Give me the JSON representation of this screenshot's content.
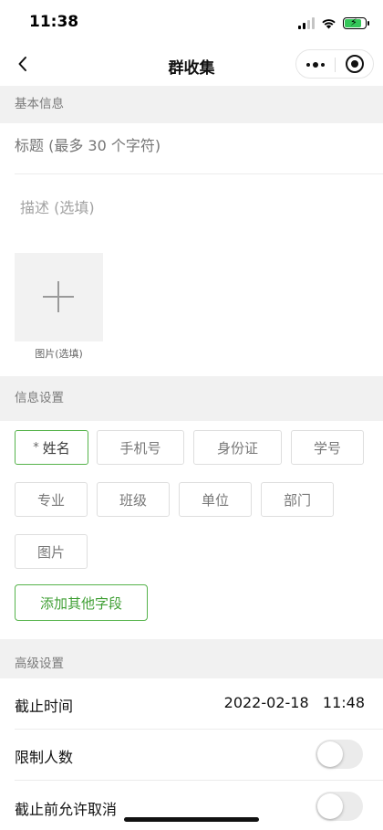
{
  "status_bar": {
    "time": "11:38"
  },
  "nav": {
    "title": "群收集"
  },
  "basic_info": {
    "header": "基本信息",
    "title_placeholder": "标题 (最多 30 个字符)",
    "description_placeholder": "描述 (选填)",
    "image_label": "图片(选填)"
  },
  "info_settings": {
    "header": "信息设置",
    "required_marker": "*",
    "fields": [
      "姓名",
      "手机号",
      "身份证",
      "学号",
      "专业",
      "班级",
      "单位",
      "部门",
      "图片"
    ],
    "selected_field": "姓名",
    "add_button": "添加其他字段"
  },
  "advanced": {
    "header": "高级设置",
    "deadline_label": "截止时间",
    "deadline_value": "2022-02-18   11:48",
    "limit_label": "限制人数",
    "limit_enabled": false,
    "allow_cancel_label": "截止前允许取消",
    "allow_cancel_enabled": false
  },
  "colors": {
    "accent_green": "#56b34b",
    "section_bg": "#f1f1f1",
    "battery_green": "#34c759"
  },
  "icons": [
    "back-arrow-icon",
    "more-dots-icon",
    "target-icon",
    "plus-icon",
    "wifi-icon",
    "signal-icon",
    "battery-charging-icon"
  ]
}
